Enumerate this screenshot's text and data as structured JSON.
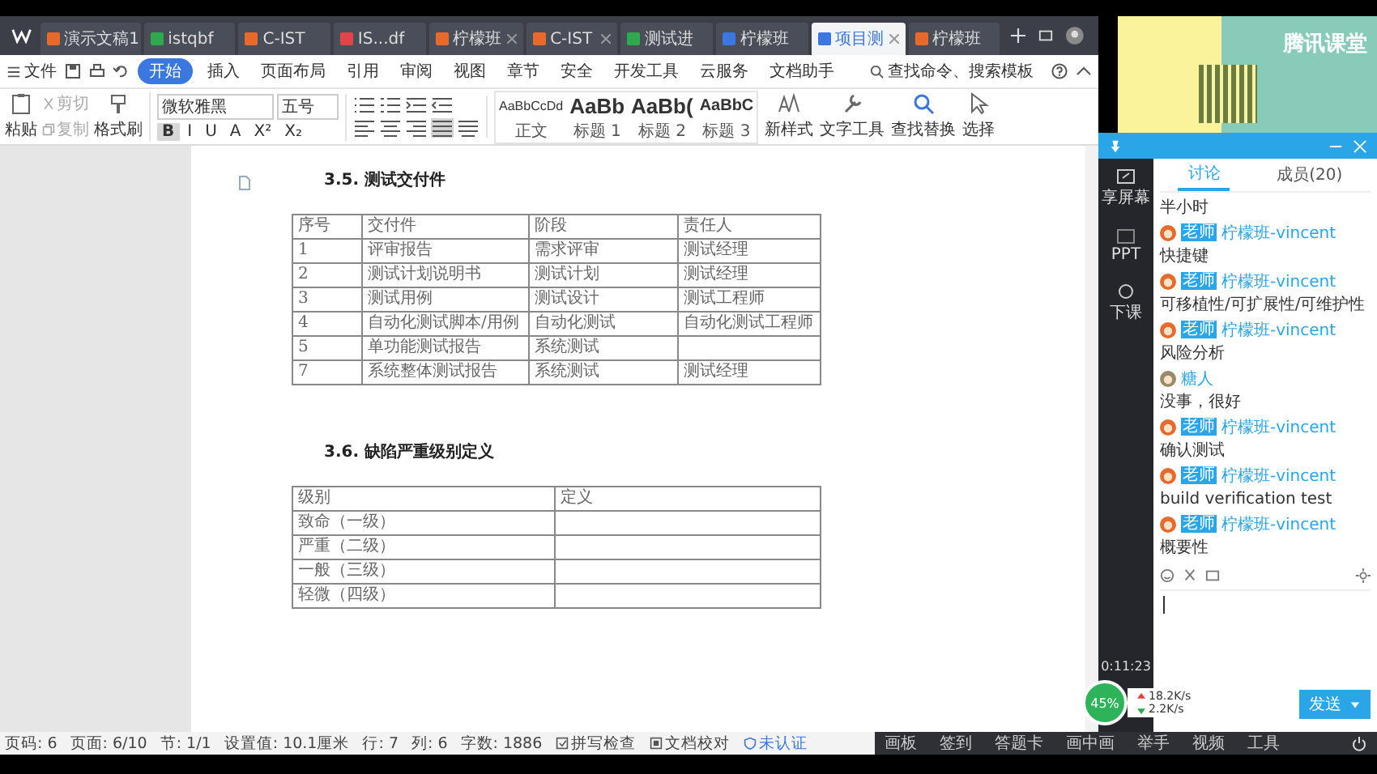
{
  "doc_tabs": [
    {
      "label": "演示文稿1",
      "color": "#e8692c",
      "selected": false,
      "closable": false
    },
    {
      "label": "istqbf",
      "color": "#2fa84f",
      "selected": false,
      "closable": false
    },
    {
      "label": "C-IST",
      "color": "#e8692c",
      "selected": false,
      "closable": false
    },
    {
      "label": "IS...df",
      "color": "#e0454a",
      "selected": false,
      "closable": false
    },
    {
      "label": "柠檬班",
      "color": "#e8692c",
      "selected": false,
      "closable": true
    },
    {
      "label": "C-IST",
      "color": "#e8692c",
      "selected": false,
      "closable": true
    },
    {
      "label": "测试进",
      "color": "#2fa84f",
      "selected": false,
      "closable": false
    },
    {
      "label": "柠檬班",
      "color": "#3a78e0",
      "selected": false,
      "closable": false
    },
    {
      "label": "项目测",
      "color": "#3a78e0",
      "selected": true,
      "closable": true
    },
    {
      "label": "柠檬班",
      "color": "#e8692c",
      "selected": false,
      "closable": false
    }
  ],
  "menu": {
    "file": "文件",
    "items": [
      {
        "label": "开始",
        "selected": true
      },
      {
        "label": "插入",
        "selected": false
      },
      {
        "label": "页面布局",
        "selected": false
      },
      {
        "label": "引用",
        "selected": false
      },
      {
        "label": "审阅",
        "selected": false
      },
      {
        "label": "视图",
        "selected": false
      },
      {
        "label": "章节",
        "selected": false
      },
      {
        "label": "安全",
        "selected": false
      },
      {
        "label": "开发工具",
        "selected": false
      },
      {
        "label": "云服务",
        "selected": false
      },
      {
        "label": "文档助手",
        "selected": false
      }
    ],
    "search": {
      "placeholder": "查找命令、搜索模板"
    }
  },
  "toolbar": {
    "paste": "粘贴",
    "cut": "剪切",
    "copy": "复制",
    "format_painter": "格式刷",
    "font": "微软雅黑",
    "size": "五号",
    "format_buttons": [
      {
        "label": "B",
        "selected": true
      },
      {
        "label": "I",
        "selected": false
      },
      {
        "label": "U",
        "selected": false
      },
      {
        "label": "A",
        "selected": false
      },
      {
        "label": "X²",
        "selected": false
      },
      {
        "label": "X₂",
        "selected": false
      }
    ],
    "align_buttons": [
      {
        "kind": "left",
        "selected": false
      },
      {
        "kind": "center",
        "selected": false
      },
      {
        "kind": "right",
        "selected": false
      },
      {
        "kind": "justify",
        "selected": true
      },
      {
        "kind": "distributed",
        "selected": false
      }
    ],
    "styles": [
      {
        "sample": "AaBbCcDd",
        "label": "正文",
        "kind": "small"
      },
      {
        "sample": "AaBb",
        "label": "标题 1",
        "kind": "large"
      },
      {
        "sample": "AaBb(",
        "label": "标题 2",
        "kind": "large"
      },
      {
        "sample": "AaBbC",
        "label": "标题 3",
        "kind": "medium"
      }
    ],
    "tools": [
      {
        "label": "新样式",
        "kind": "styles"
      },
      {
        "label": "文字工具",
        "kind": "wrench"
      },
      {
        "label": "查找替换",
        "kind": "search"
      },
      {
        "label": "选择",
        "kind": "pointer"
      }
    ]
  },
  "document": {
    "section_1": {
      "heading": "3.5. 测试交付件",
      "table": {
        "columns": [
          "序号",
          "交付件",
          "阶段",
          "责任人"
        ],
        "rows": [
          [
            "1",
            "评审报告",
            "需求评审",
            "测试经理"
          ],
          [
            "2",
            "测试计划说明书",
            "测试计划",
            "测试经理"
          ],
          [
            "3",
            "测试用例",
            "测试设计",
            "测试工程师"
          ],
          [
            "4",
            "自动化测试脚本/用例",
            "自动化测试",
            "自动化测试工程师"
          ],
          [
            "5",
            "单功能测试报告",
            "系统测试",
            ""
          ],
          [
            "7",
            "系统整体测试报告",
            "系统测试",
            "测试经理"
          ]
        ]
      }
    },
    "section_2": {
      "heading": "3.6. 缺陷严重级别定义",
      "table": {
        "columns": [
          "级别",
          "定义"
        ],
        "rows": [
          [
            "致命（一级）",
            ""
          ],
          [
            "严重（二级）",
            ""
          ],
          [
            "一般（三级）",
            ""
          ],
          [
            "轻微（四级）",
            ""
          ]
        ]
      }
    }
  },
  "status_bar": [
    "页码: 6",
    "页面: 6/10",
    "节: 1/1",
    "设置值: 10.1厘米",
    "行: 7",
    "列: 6",
    "字数: 1886"
  ],
  "status_tools": {
    "spell": "拼写检查",
    "proof": "文档校对",
    "cert": "未认证"
  },
  "classroom": {
    "logo": "腾讯课堂",
    "side_tools": [
      {
        "label": "享屏幕",
        "kind": "share"
      },
      {
        "label": "PPT",
        "kind": "ppt"
      },
      {
        "label": "下课",
        "kind": "end"
      }
    ],
    "timer": "0:11:23",
    "chat_tabs": [
      {
        "label": "讨论",
        "selected": true
      },
      {
        "label": "成员(20)",
        "selected": false
      }
    ],
    "messages": [
      {
        "kind": "text",
        "text": "半小时"
      },
      {
        "kind": "teacher",
        "badge": "老师",
        "name": "柠檬班-vincent",
        "text": "快捷键"
      },
      {
        "kind": "teacher",
        "badge": "老师",
        "name": "柠檬班-vincent",
        "text": "可移植性/可扩展性/可维护性"
      },
      {
        "kind": "teacher",
        "badge": "老师",
        "name": "柠檬班-vincent",
        "text": "风险分析"
      },
      {
        "kind": "student",
        "name": "糖人",
        "text": "没事，很好"
      },
      {
        "kind": "teacher",
        "badge": "老师",
        "name": "柠檬班-vincent",
        "text": "确认测试"
      },
      {
        "kind": "teacher",
        "badge": "老师",
        "name": "柠檬班-vincent",
        "text": "build verification test"
      },
      {
        "kind": "teacher",
        "badge": "老师",
        "name": "柠檬班-vincent",
        "text": "概要性"
      }
    ],
    "send": "发送",
    "bottom_bar": [
      "画板",
      "签到",
      "答题卡",
      "画中画",
      "举手",
      "视频",
      "工具"
    ]
  },
  "network": {
    "cpu": "45%",
    "up": "18.2K/s",
    "down": "2.2K/s"
  }
}
